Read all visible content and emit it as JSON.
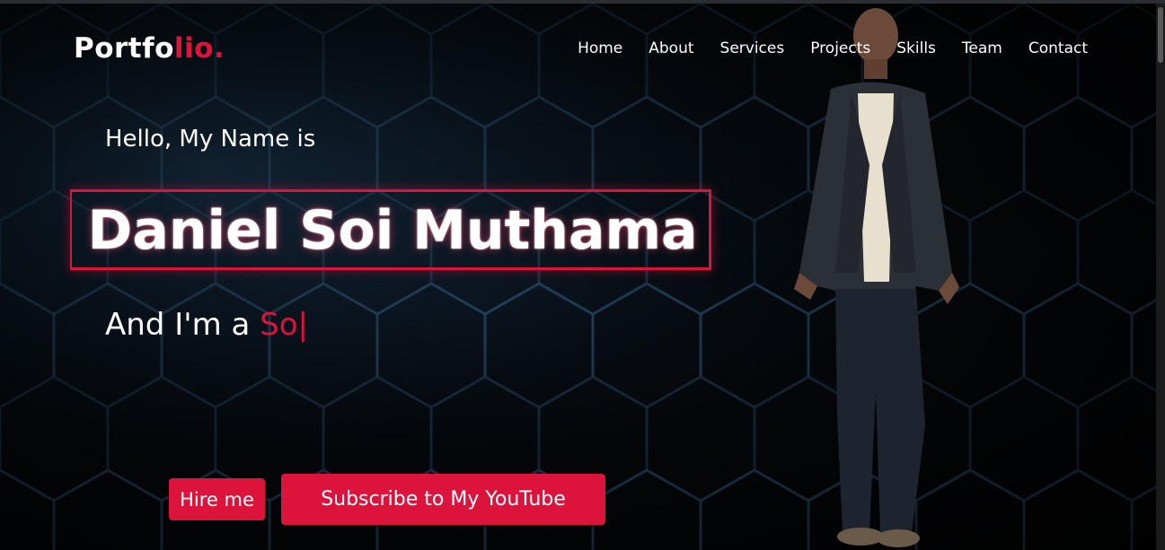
{
  "navbar": {
    "logo_main": "Portfo",
    "logo_accent": "lio.",
    "menu": [
      {
        "label": "Home"
      },
      {
        "label": "About"
      },
      {
        "label": "Services"
      },
      {
        "label": "Projects"
      },
      {
        "label": "Skills"
      },
      {
        "label": "Team"
      },
      {
        "label": "Contact"
      }
    ]
  },
  "hero": {
    "greeting": "Hello, My Name is",
    "name": "Daniel Soi Muthama",
    "role_prefix": "And I'm a ",
    "role_typed": "So",
    "cursor": "|",
    "hire_button": "Hire me",
    "youtube_button": "Subscribe to My YouTube"
  },
  "colors": {
    "accent": "#dc143c",
    "background": "#050608",
    "text": "#ffffff"
  },
  "icons": {
    "background": "hexagon-pattern",
    "portrait": "person-photo"
  }
}
